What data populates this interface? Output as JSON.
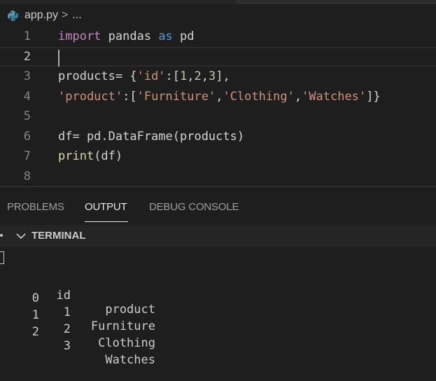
{
  "breadcrumb": {
    "file": "app.py",
    "separator": ">",
    "ellipsis": "..."
  },
  "editor": {
    "current_line": 2,
    "lines": [
      {
        "number": "1",
        "tokens": [
          {
            "t": "import",
            "c": "kw"
          },
          {
            "t": " pandas ",
            "c": "pl"
          },
          {
            "t": "as",
            "c": "kw2"
          },
          {
            "t": " pd",
            "c": "pl"
          }
        ]
      },
      {
        "number": "2",
        "tokens": []
      },
      {
        "number": "3",
        "tokens": [
          {
            "t": "products= {",
            "c": "pl"
          },
          {
            "t": "'id'",
            "c": "str"
          },
          {
            "t": ":[",
            "c": "pl"
          },
          {
            "t": "1",
            "c": "num-lit"
          },
          {
            "t": ",",
            "c": "pl"
          },
          {
            "t": "2",
            "c": "num-lit"
          },
          {
            "t": ",",
            "c": "pl"
          },
          {
            "t": "3",
            "c": "num-lit"
          },
          {
            "t": "],",
            "c": "pl"
          }
        ]
      },
      {
        "number": "4",
        "tokens": [
          {
            "t": "'product'",
            "c": "str"
          },
          {
            "t": ":[",
            "c": "pl"
          },
          {
            "t": "'Furniture'",
            "c": "str"
          },
          {
            "t": ",",
            "c": "pl"
          },
          {
            "t": "'Clothing'",
            "c": "str"
          },
          {
            "t": ",",
            "c": "pl"
          },
          {
            "t": "'Watches'",
            "c": "str"
          },
          {
            "t": "]}",
            "c": "pl"
          }
        ]
      },
      {
        "number": "5",
        "tokens": []
      },
      {
        "number": "6",
        "tokens": [
          {
            "t": "df= pd.DataFrame(products)",
            "c": "pl"
          }
        ]
      },
      {
        "number": "7",
        "tokens": [
          {
            "t": "print",
            "c": "fn"
          },
          {
            "t": "(df)",
            "c": "pl"
          }
        ]
      },
      {
        "number": "8",
        "tokens": []
      }
    ]
  },
  "panel": {
    "tabs": [
      {
        "label": "PROBLEMS",
        "active": false
      },
      {
        "label": "OUTPUT",
        "active": true
      },
      {
        "label": "DEBUG CONSOLE",
        "active": false
      }
    ]
  },
  "terminal": {
    "title": "TERMINAL",
    "header": {
      "index": "",
      "id": "id",
      "product": "product"
    },
    "rows": [
      {
        "index": "0",
        "id": "1",
        "product": "Furniture"
      },
      {
        "index": "1",
        "id": "2",
        "product": "Clothing"
      },
      {
        "index": "2",
        "id": "3",
        "product": "Watches"
      }
    ]
  },
  "colors": {
    "background": "#1e1e1e",
    "keyword": "#c586c0",
    "keyword_blue": "#569cd6",
    "string": "#ce9178",
    "number": "#b5cea8",
    "function": "#dcdcaa"
  }
}
